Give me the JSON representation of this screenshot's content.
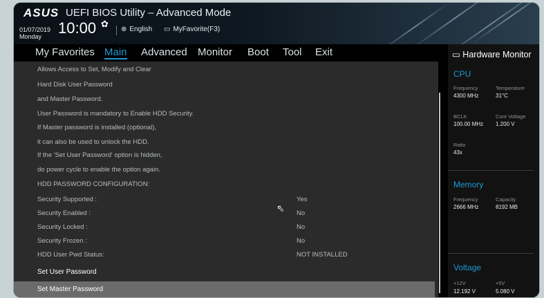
{
  "header": {
    "logo_text": "ASUS",
    "title": "UEFI BIOS Utility – Advanced Mode",
    "date": "01/07/2019",
    "weekday": "Monday",
    "time": "10:00",
    "language": "English",
    "my_favorite": "MyFavorite(F3)",
    "icons": [
      "gear-icon",
      "globe-icon",
      "favorite-icon"
    ]
  },
  "tabs": [
    {
      "label": "My Favorites",
      "active": false
    },
    {
      "label": "Main",
      "active": true
    },
    {
      "label": "Advanced",
      "active": false
    },
    {
      "label": "Monitor",
      "active": false
    },
    {
      "label": "Boot",
      "active": false
    },
    {
      "label": "Tool",
      "active": false
    },
    {
      "label": "Exit",
      "active": false
    }
  ],
  "main": {
    "help_lines": [
      "Allows Access to Set, Modify and Clear",
      "Hard Disk  User  Password",
      "and  Master  Password.",
      "User Password is mandatory to Enable HDD Security.",
      "If Master password is installed (optional),",
      "it can also be used to unlock the HDD.",
      "If the 'Set User Password' option is hidden,",
      "do power cycle to enable the option again."
    ],
    "section_heading": "HDD PASSWORD CONFIGURATION:",
    "rows": [
      {
        "label": "Security Supported :",
        "value": "Yes"
      },
      {
        "label": "Security Enabled  :",
        "value": "No"
      },
      {
        "label": "Security Locked   :",
        "value": "No"
      },
      {
        "label": "Security Frozen   :",
        "value": "No"
      },
      {
        "label": "HDD User Pwd Status:",
        "value": "NOT INSTALLED"
      }
    ],
    "actions": [
      "Set User Password",
      "Set Master Password"
    ],
    "selected_action": "Set Master Password"
  },
  "hardware_monitor": {
    "title": "Hardware Monitor",
    "cpu": {
      "heading": "CPU",
      "frequency_label": "Frequency",
      "frequency": "4300 MHz",
      "temperature_label": "Temperature",
      "temperature": "31°C",
      "bclk_label": "BCLK",
      "bclk": "100.00 MHz",
      "core_voltage_label": "Core Voltage",
      "core_voltage": "1.200 V",
      "ratio_label": "Ratio",
      "ratio": "43x"
    },
    "memory": {
      "heading": "Memory",
      "frequency_label": "Frequency",
      "frequency": "2666 MHz",
      "capacity_label": "Capacity",
      "capacity": "8192 MB"
    },
    "voltage": {
      "heading": "Voltage",
      "v12_label": "+12V",
      "v12": "12.192 V",
      "v5_label": "+5V",
      "v5": "5.080 V"
    }
  },
  "colors": {
    "accent": "#1e9ad6",
    "selected_row": "#6b6b6b",
    "panel_bg": "#2b2b2b"
  }
}
